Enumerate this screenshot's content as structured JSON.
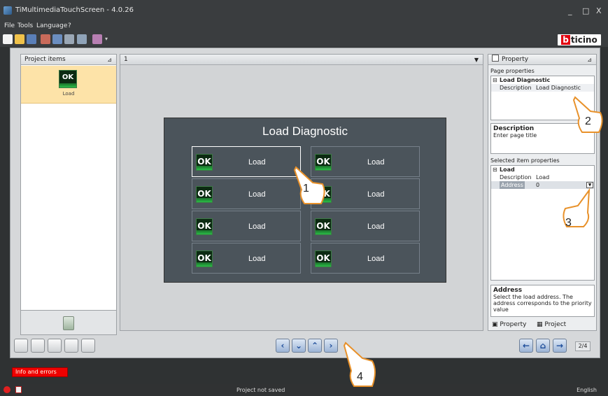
{
  "window": {
    "title": "TiMultimediaTouchScreen - 4.0.26",
    "min": "_",
    "max": "□",
    "close": "X"
  },
  "menu": [
    "File",
    "Tools",
    "Language",
    "?"
  ],
  "brand": {
    "logo_b": "b",
    "logo_rest": "ticino"
  },
  "left_panel": {
    "header": "Project items",
    "item_label": "Load",
    "icon_text": "OK"
  },
  "center": {
    "page_tab": "1",
    "page_title": "Load Diagnostic"
  },
  "tiles": [
    {
      "ok": "OK",
      "label": "Load"
    },
    {
      "ok": "OK",
      "label": "Load"
    },
    {
      "ok": "OK",
      "label": "Load"
    },
    {
      "ok": "OK",
      "label": "Load"
    },
    {
      "ok": "OK",
      "label": "Load"
    },
    {
      "ok": "OK",
      "label": "Load"
    },
    {
      "ok": "OK",
      "label": "Load"
    },
    {
      "ok": "OK",
      "label": "Load"
    }
  ],
  "property": {
    "header": "Property",
    "page_props": "Page properties",
    "page_group": "Load Diagnostic",
    "page_desc_key": "Description",
    "page_desc_val": "Load Diagnostic",
    "desc_title": "Description",
    "desc_text": "Enter page title",
    "sel_props": "Selected item properties",
    "item_group": "Load",
    "item_desc_key": "Description",
    "item_desc_val": "Load",
    "item_addr_key": "Address",
    "item_addr_val": "0",
    "addr_title": "Address",
    "addr_text": "Select the load address. The address corresponds to the priority value",
    "tab_property": "Property",
    "tab_project": "Project"
  },
  "page_counter": "2/4",
  "info_button": "Info and errors",
  "status": {
    "text": "Project not saved",
    "language": "English"
  },
  "callouts": [
    "1",
    "2",
    "3",
    "4"
  ],
  "colors": {
    "accent_green": "#2bbd47",
    "selection": "#fde3a8",
    "error": "#ee0000",
    "brand_red": "#e3000f"
  }
}
